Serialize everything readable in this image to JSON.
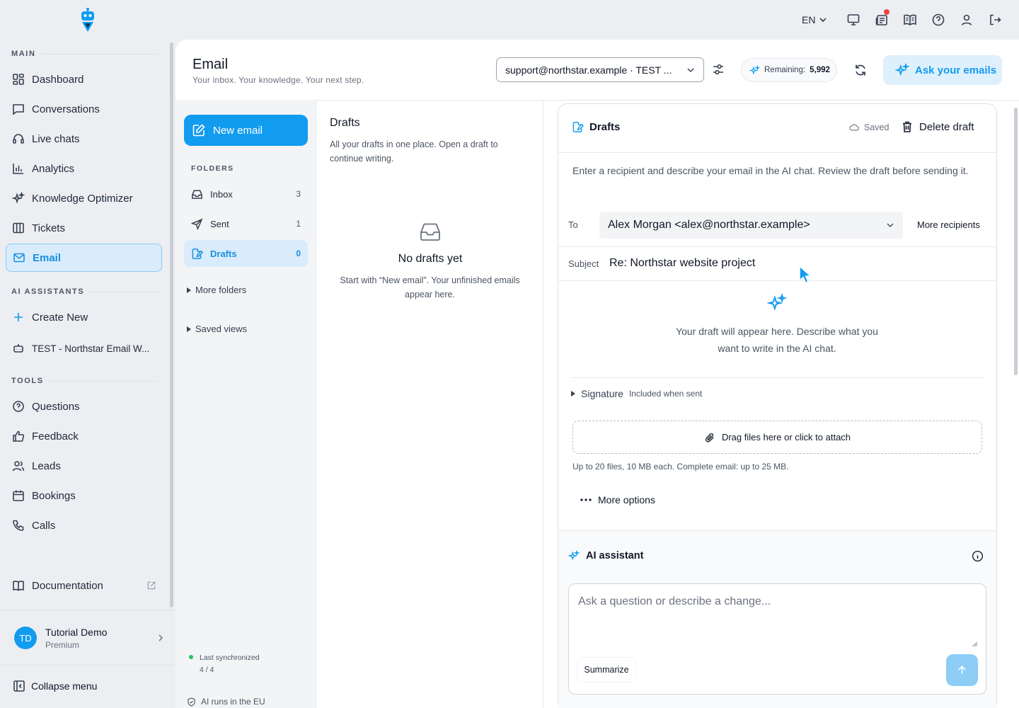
{
  "topbar": {
    "language": "EN"
  },
  "sidebar": {
    "sections": {
      "main": "MAIN",
      "ai": "AI ASSISTANTS",
      "tools": "TOOLS"
    },
    "main_items": [
      {
        "label": "Dashboard",
        "icon": "dashboard-icon"
      },
      {
        "label": "Conversations",
        "icon": "chat-bubble-icon"
      },
      {
        "label": "Live chats",
        "icon": "headset-icon"
      },
      {
        "label": "Analytics",
        "icon": "bar-chart-icon"
      },
      {
        "label": "Knowledge Optimizer",
        "icon": "sparkle-icon"
      },
      {
        "label": "Tickets",
        "icon": "columns-icon"
      },
      {
        "label": "Email",
        "icon": "mail-icon"
      }
    ],
    "ai_items": [
      {
        "label": "Create New",
        "icon": "plus-icon"
      },
      {
        "label": "TEST - Northstar Email W...",
        "icon": "bot-icon"
      }
    ],
    "tool_items": [
      {
        "label": "Questions",
        "icon": "question-circle-icon"
      },
      {
        "label": "Feedback",
        "icon": "thumbs-up-icon"
      },
      {
        "label": "Leads",
        "icon": "users-icon"
      },
      {
        "label": "Bookings",
        "icon": "calendar-icon"
      },
      {
        "label": "Calls",
        "icon": "phone-icon"
      }
    ],
    "documentation": "Documentation",
    "user": {
      "initials": "TD",
      "name": "Tutorial Demo",
      "plan": "Premium"
    },
    "collapse": "Collapse menu"
  },
  "header": {
    "title": "Email",
    "subtitle": "Your inbox. Your knowledge. Your next step.",
    "account_select": "support@northstar.example · TEST ...",
    "remaining_label": "Remaining:",
    "remaining_value": "5,992",
    "ask_button": "Ask your emails"
  },
  "folders_pane": {
    "new_email": "New email",
    "folders_heading": "FOLDERS",
    "folders": [
      {
        "label": "Inbox",
        "count": "3"
      },
      {
        "label": "Sent",
        "count": "1"
      },
      {
        "label": "Drafts",
        "count": "0"
      }
    ],
    "more_folders": "More folders",
    "saved_views": "Saved views",
    "sync_label": "Last synchronized",
    "sync_value": "4 / 4",
    "ai_eu": "AI runs in the EU"
  },
  "drafts_list": {
    "title": "Drafts",
    "description": "All your drafts in one place. Open a draft to continue writing.",
    "empty_title": "No drafts yet",
    "empty_text": "Start with “New email”. Your unfinished emails appear here."
  },
  "editor": {
    "title": "Drafts",
    "saved": "Saved",
    "delete": "Delete draft",
    "instructions": "Enter a recipient and describe your email in the AI chat. Review the draft before sending it.",
    "to_label": "To",
    "to_value": "Alex Morgan <alex@northstar.example>",
    "more_recipients": "More recipients",
    "subject_label": "Subject",
    "subject_value": "Re: Northstar website project",
    "placeholder_text": "Your draft will appear here. Describe what you want to write in the AI chat.",
    "signature_label": "Signature",
    "signature_note": "Included when sent",
    "attach": "Drag files here or click to attach",
    "attach_limits": "Up to 20 files, 10 MB each. Complete email: up to 25 MB.",
    "more_options": "More options"
  },
  "ai_assistant": {
    "title": "AI assistant",
    "input_placeholder": "Ask a question or describe a change...",
    "summarize": "Summarize"
  },
  "colors": {
    "accent": "#129cf0",
    "active_bg": "#d9ecfc",
    "sidebar_bg": "#eceef2"
  }
}
